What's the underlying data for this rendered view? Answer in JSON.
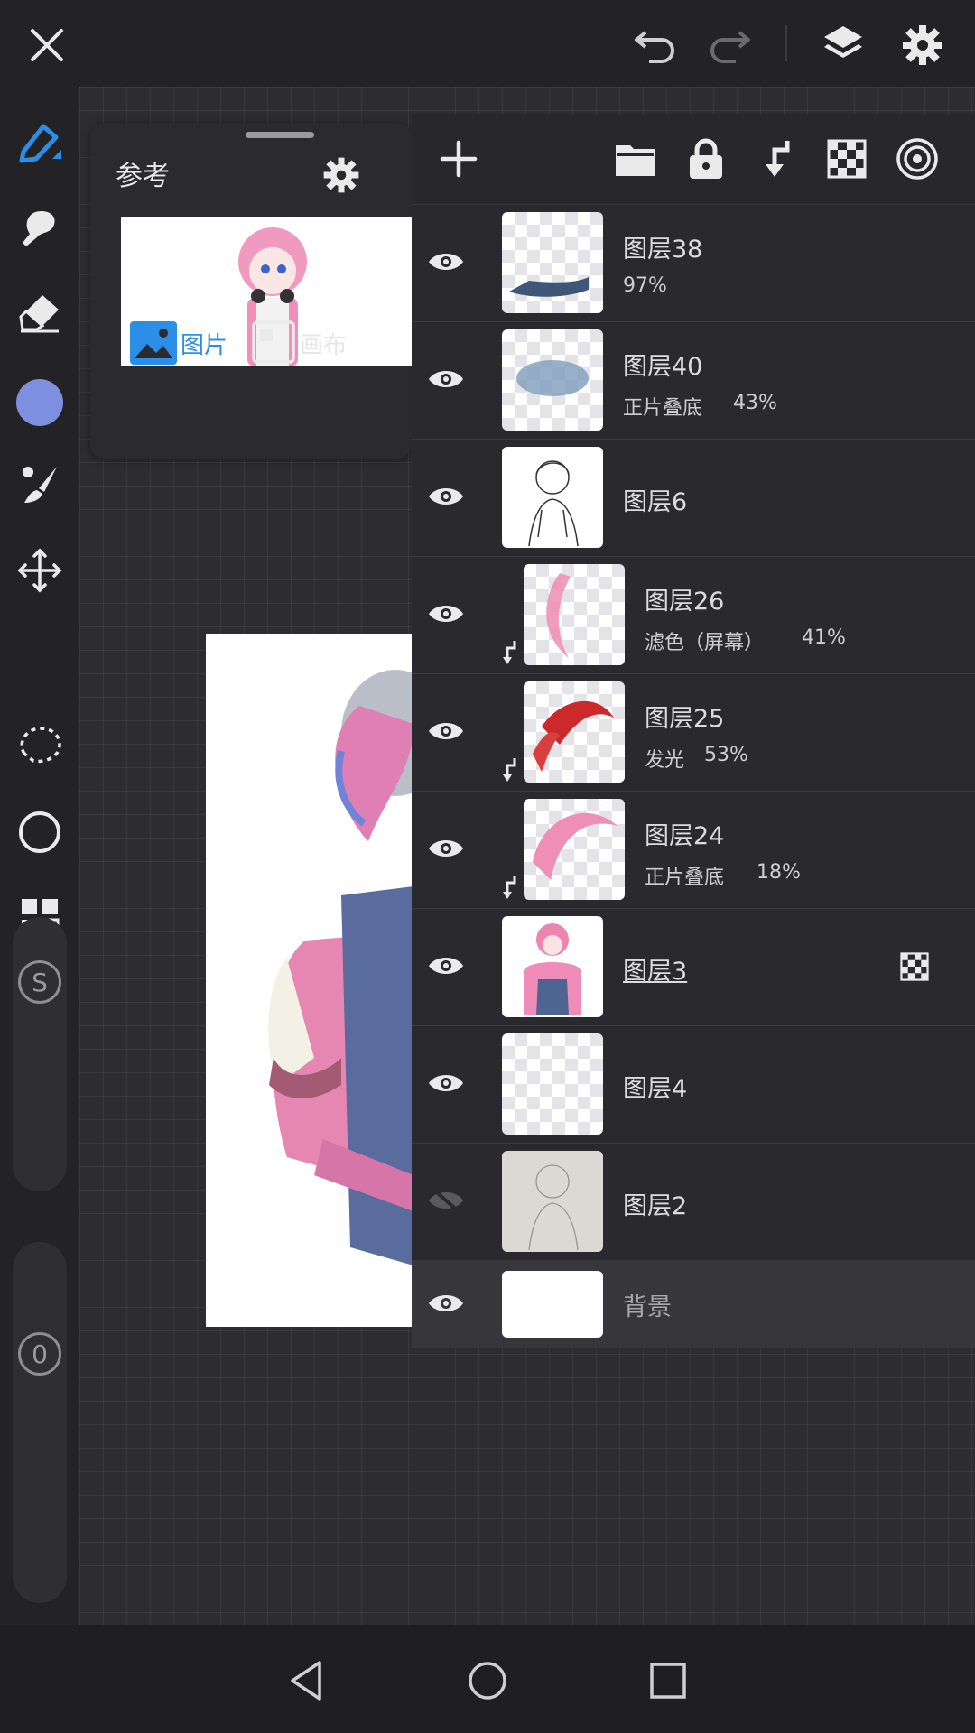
{
  "reference": {
    "title": "参考",
    "tab_image": "图片",
    "tab_canvas": "画布"
  },
  "layers": [
    {
      "name": "图层38",
      "blend": "",
      "opacity": "97%",
      "visible": true,
      "clipped": false
    },
    {
      "name": "图层40",
      "blend": "正片叠底",
      "opacity": "43%",
      "visible": true,
      "clipped": false
    },
    {
      "name": "图层6",
      "blend": "",
      "opacity": "",
      "visible": true,
      "clipped": false
    },
    {
      "name": "图层26",
      "blend": "滤色（屏幕）",
      "opacity": "41%",
      "visible": true,
      "clipped": true
    },
    {
      "name": "图层25",
      "blend": "发光",
      "opacity": "53%",
      "visible": true,
      "clipped": true
    },
    {
      "name": "图层24",
      "blend": "正片叠底",
      "opacity": "18%",
      "visible": true,
      "clipped": true
    },
    {
      "name": "图层3",
      "blend": "",
      "opacity": "",
      "visible": true,
      "clipped": false,
      "active": true
    },
    {
      "name": "图层4",
      "blend": "",
      "opacity": "",
      "visible": true,
      "clipped": false
    },
    {
      "name": "图层2",
      "blend": "",
      "opacity": "",
      "visible": false,
      "clipped": false
    }
  ],
  "background_layer": {
    "name": "背景"
  },
  "tool_sliders": {
    "size_label": "S",
    "opacity_label": "0"
  },
  "colors": {
    "current_color": "#7f8fe0",
    "accent": "#2b8fe8"
  }
}
